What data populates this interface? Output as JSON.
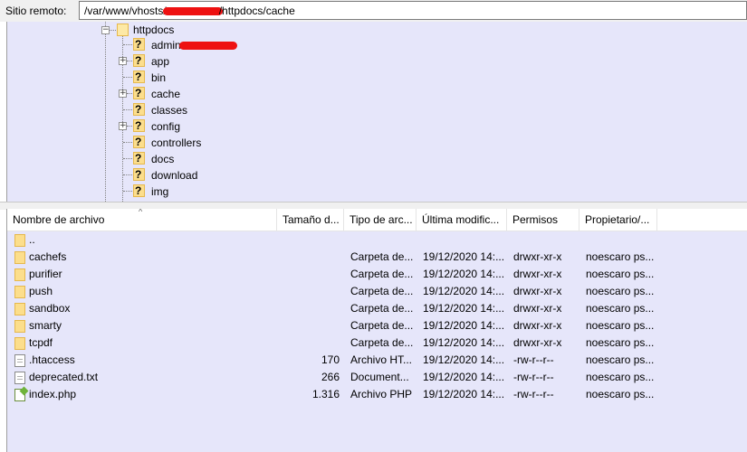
{
  "remote": {
    "label": "Sitio remoto:",
    "path_before": "/var/www/vhosts/",
    "path_after": "/httpdocs/cache"
  },
  "tree": {
    "root": "httpdocs",
    "items": [
      {
        "label": "admin",
        "expandable": false
      },
      {
        "label": "app",
        "expandable": true
      },
      {
        "label": "bin",
        "expandable": false
      },
      {
        "label": "cache",
        "expandable": true
      },
      {
        "label": "classes",
        "expandable": false
      },
      {
        "label": "config",
        "expandable": true
      },
      {
        "label": "controllers",
        "expandable": false
      },
      {
        "label": "docs",
        "expandable": false
      },
      {
        "label": "download",
        "expandable": false
      },
      {
        "label": "img",
        "expandable": false
      }
    ]
  },
  "columns": {
    "name": "Nombre de archivo",
    "size": "Tamaño d...",
    "type": "Tipo de arc...",
    "modified": "Última modific...",
    "perms": "Permisos",
    "owner": "Propietario/..."
  },
  "files": [
    {
      "name": "..",
      "size": "",
      "type": "",
      "modified": "",
      "perms": "",
      "owner": "",
      "icon": "folder-icon"
    },
    {
      "name": "cachefs",
      "size": "",
      "type": "Carpeta de...",
      "modified": "19/12/2020 14:...",
      "perms": "drwxr-xr-x",
      "owner": "noescaro ps...",
      "icon": "folder-icon"
    },
    {
      "name": "purifier",
      "size": "",
      "type": "Carpeta de...",
      "modified": "19/12/2020 14:...",
      "perms": "drwxr-xr-x",
      "owner": "noescaro ps...",
      "icon": "folder-icon"
    },
    {
      "name": "push",
      "size": "",
      "type": "Carpeta de...",
      "modified": "19/12/2020 14:...",
      "perms": "drwxr-xr-x",
      "owner": "noescaro ps...",
      "icon": "folder-icon"
    },
    {
      "name": "sandbox",
      "size": "",
      "type": "Carpeta de...",
      "modified": "19/12/2020 14:...",
      "perms": "drwxr-xr-x",
      "owner": "noescaro ps...",
      "icon": "folder-icon"
    },
    {
      "name": "smarty",
      "size": "",
      "type": "Carpeta de...",
      "modified": "19/12/2020 14:...",
      "perms": "drwxr-xr-x",
      "owner": "noescaro ps...",
      "icon": "folder-icon"
    },
    {
      "name": "tcpdf",
      "size": "",
      "type": "Carpeta de...",
      "modified": "19/12/2020 14:...",
      "perms": "drwxr-xr-x",
      "owner": "noescaro ps...",
      "icon": "folder-icon"
    },
    {
      "name": ".htaccess",
      "size": "170",
      "type": "Archivo HT...",
      "modified": "19/12/2020 14:...",
      "perms": "-rw-r--r--",
      "owner": "noescaro ps...",
      "icon": "file-icon"
    },
    {
      "name": "deprecated.txt",
      "size": "266",
      "type": "Document...",
      "modified": "19/12/2020 14:...",
      "perms": "-rw-r--r--",
      "owner": "noescaro ps...",
      "icon": "text-file-icon"
    },
    {
      "name": "index.php",
      "size": "1.316",
      "type": "Archivo PHP",
      "modified": "19/12/2020 14:...",
      "perms": "-rw-r--r--",
      "owner": "noescaro ps...",
      "icon": "php-file-icon"
    }
  ],
  "colors": {
    "panel_background": "#e6e6fa",
    "redaction": "#ee1111",
    "folder": "#fcde8c"
  }
}
